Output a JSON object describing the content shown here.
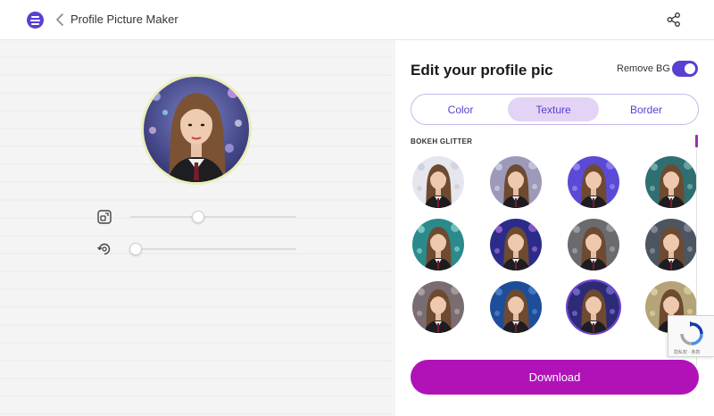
{
  "header": {
    "title": "Profile Picture Maker",
    "logo_icon": "app-logo",
    "back_icon": "chevron-left-icon",
    "share_icon": "share-icon"
  },
  "editor": {
    "sliders": [
      {
        "name": "zoom",
        "icon": "zoom-square-icon",
        "value": 0.41
      },
      {
        "name": "rotate",
        "icon": "rotate-icon",
        "value": 0.03
      }
    ]
  },
  "panel": {
    "title": "Edit your profile pic",
    "remove_bg_label": "Remove BG",
    "remove_bg_enabled": true,
    "tabs": [
      {
        "label": "Color",
        "active": false
      },
      {
        "label": "Texture",
        "active": true
      },
      {
        "label": "Border",
        "active": false
      }
    ],
    "section_label": "BOKEH GLITTER",
    "textures": [
      {
        "bg": "#e6e7ee",
        "accent": "#c9ccd8"
      },
      {
        "bg": "#9c9ab8",
        "accent": "#cfd2e6"
      },
      {
        "bg": "#5a4ad6",
        "accent": "#9b8cf0"
      },
      {
        "bg": "#2f6f72",
        "accent": "#7fb7b3"
      },
      {
        "bg": "#2a8a8c",
        "accent": "#8fd3cf"
      },
      {
        "bg": "#2b2c8a",
        "accent": "#a86bd8"
      },
      {
        "bg": "#6b6b6f",
        "accent": "#a6a6aa"
      },
      {
        "bg": "#4d5660",
        "accent": "#8a959f"
      },
      {
        "bg": "#7a6d72",
        "accent": "#b4a9ab"
      },
      {
        "bg": "#1e4e9a",
        "accent": "#4f86d0"
      },
      {
        "bg": "#2d2a78",
        "accent": "#7c72d6",
        "selected": true
      },
      {
        "bg": "#b5a478",
        "accent": "#e0d3a8"
      }
    ],
    "download_label": "Download"
  },
  "recaptcha": {
    "terms": "隐私权 · 条款"
  },
  "colors": {
    "accent": "#5a3fd1",
    "download": "#b012b8",
    "tab_active": "#e3d4f5"
  }
}
